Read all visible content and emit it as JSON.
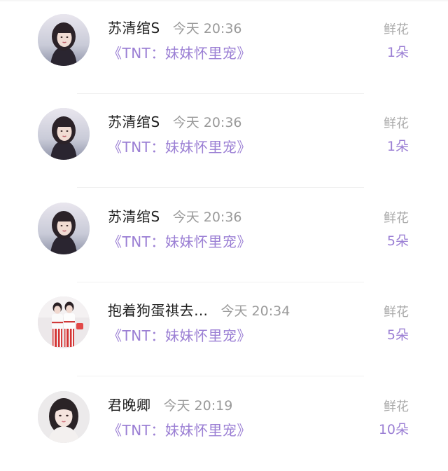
{
  "gift_list": {
    "entries": [
      {
        "avatar_icon": "female-portrait-avatar-icon",
        "user": "苏清绾S",
        "time": "今天 20:36",
        "book": "《TNT：妹妹怀里宠》",
        "gift_type": "鲜花",
        "count": "1朵"
      },
      {
        "avatar_icon": "female-portrait-avatar-icon",
        "user": "苏清绾S",
        "time": "今天 20:36",
        "book": "《TNT：妹妹怀里宠》",
        "gift_type": "鲜花",
        "count": "1朵"
      },
      {
        "avatar_icon": "female-portrait-avatar-icon",
        "user": "苏清绾S",
        "time": "今天 20:36",
        "book": "《TNT：妹妹怀里宠》",
        "gift_type": "鲜花",
        "count": "5朵"
      },
      {
        "avatar_icon": "two-people-avatar-icon",
        "user": "抱着狗蛋祺去…",
        "time": "今天 20:34",
        "book": "《TNT：妹妹怀里宠》",
        "gift_type": "鲜花",
        "count": "5朵"
      },
      {
        "avatar_icon": "girl-selfie-avatar-icon",
        "user": "君晚卿",
        "time": "今天 20:19",
        "book": "《TNT：妹妹怀里宠》",
        "gift_type": "鲜花",
        "count": "10朵"
      }
    ]
  },
  "colors": {
    "accent_purple": "#9b7fd4",
    "name_text": "#1f1f1f",
    "muted_text": "#9a9a9a"
  }
}
